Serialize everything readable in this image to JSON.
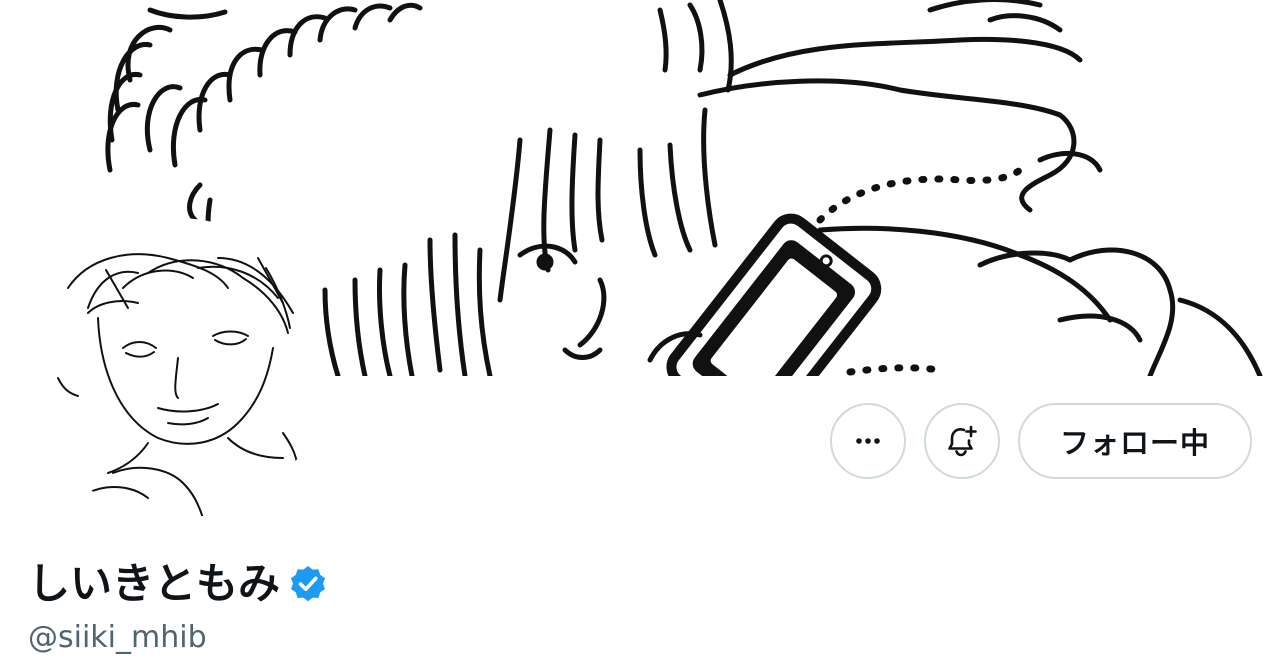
{
  "profile": {
    "display_name": "しいきともみ",
    "handle": "@siiki_mhib",
    "verified_badge_icon": "verified-badge-icon",
    "verified_color": "#1d9bf0"
  },
  "actions": {
    "more_icon": "more-dots-icon",
    "notify_icon": "bell-plus-icon",
    "follow_label": "フォロー中"
  },
  "colors": {
    "text_primary": "#0f1419",
    "text_secondary": "#536471",
    "button_border": "#cfd9de"
  }
}
